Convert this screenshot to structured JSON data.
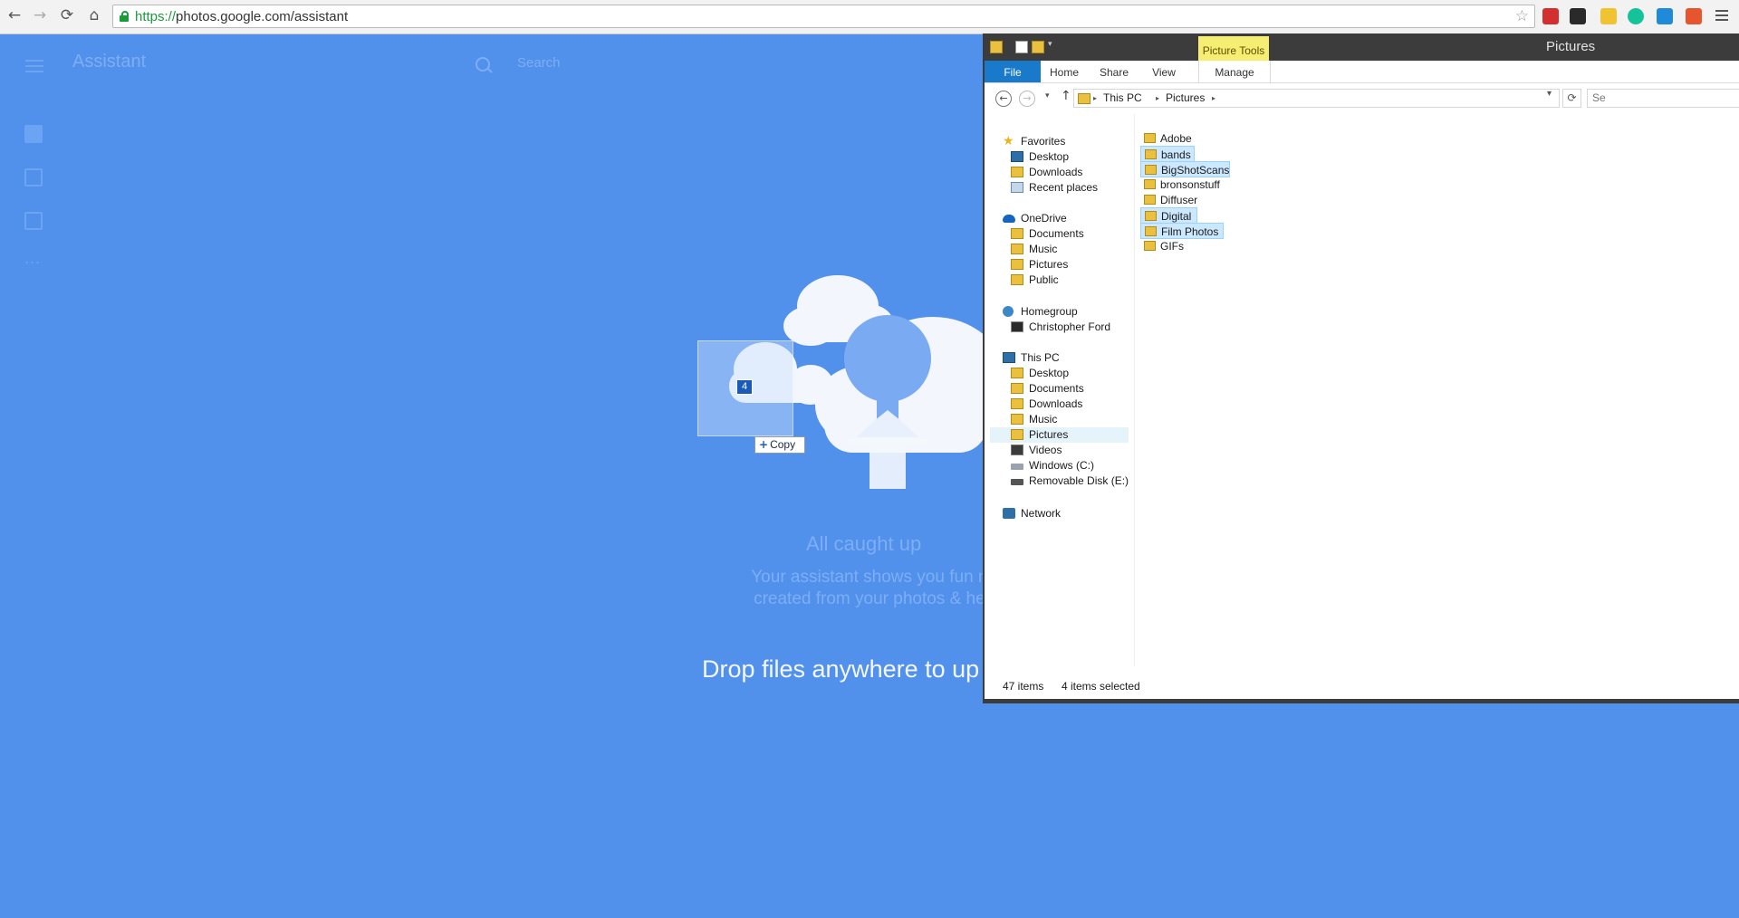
{
  "browser": {
    "url_scheme": "https://",
    "url_rest": "photos.google.com/assistant",
    "back_glyph": "←",
    "forward_glyph": "→",
    "reload_glyph": "⟳",
    "home_glyph": "⌂",
    "star_glyph": "☆",
    "extensions": [
      {
        "icon": "stop-extension-icon",
        "color": "#d42f2f"
      },
      {
        "icon": "dark-reader-extension-icon",
        "color": "#2a2a2a"
      },
      {
        "icon": "bookmark-extension-icon",
        "color": "#f0c431"
      },
      {
        "icon": "grammarly-extension-icon",
        "color": "#15c39a"
      },
      {
        "icon": "network-extension-icon",
        "color": "#1f8ad8"
      },
      {
        "icon": "color-picker-extension-icon",
        "color": "#e6552e"
      }
    ]
  },
  "photos": {
    "app_title": "Assistant",
    "search_placeholder": "Search",
    "caught_up": "All caught up",
    "assistant_desc_line1": "Your assistant shows you fun new things",
    "assistant_desc_line2": "created from your photos & helps you st",
    "drop_message": "Drop files anywhere to up"
  },
  "drag": {
    "count": "4",
    "copy_label": "Copy"
  },
  "explorer": {
    "window_title": "Pictures",
    "context_tab": "Picture Tools",
    "tabs": {
      "file": "File",
      "home": "Home",
      "share": "Share",
      "view": "View",
      "manage": "Manage"
    },
    "breadcrumb": {
      "pc": "This PC",
      "pictures": "Pictures"
    },
    "search_placeholder": "Se",
    "nav": {
      "favorites": "Favorites",
      "fav_desktop": "Desktop",
      "fav_downloads": "Downloads",
      "fav_recent": "Recent places",
      "onedrive": "OneDrive",
      "od_documents": "Documents",
      "od_music": "Music",
      "od_pictures": "Pictures",
      "od_public": "Public",
      "homegroup": "Homegroup",
      "hg_user": "Christopher Ford",
      "thispc": "This PC",
      "pc_desktop": "Desktop",
      "pc_documents": "Documents",
      "pc_downloads": "Downloads",
      "pc_music": "Music",
      "pc_pictures": "Pictures",
      "pc_videos": "Videos",
      "pc_windows": "Windows (C:)",
      "pc_removable": "Removable Disk (E:)",
      "network": "Network"
    },
    "files": [
      {
        "name": "Adobe",
        "selected": false
      },
      {
        "name": "bands",
        "selected": true
      },
      {
        "name": "BigShotScans",
        "selected": true
      },
      {
        "name": "bronsonstuff",
        "selected": false
      },
      {
        "name": "Diffuser",
        "selected": false
      },
      {
        "name": "Digital",
        "selected": true
      },
      {
        "name": "Film Photos",
        "selected": true
      },
      {
        "name": "GIFs",
        "selected": false
      }
    ],
    "status_count": "47 items",
    "status_selected": "4 items selected"
  }
}
